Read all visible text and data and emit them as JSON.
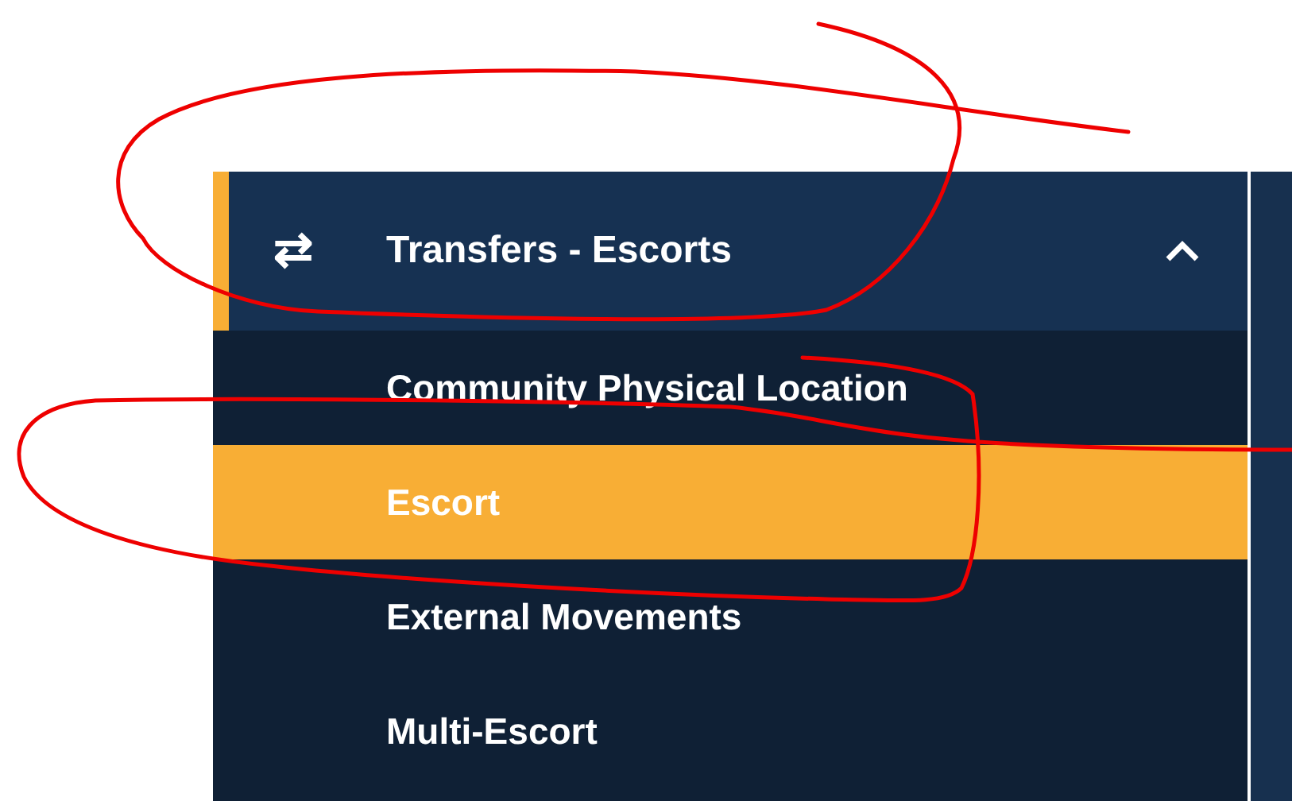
{
  "sidebar": {
    "section": {
      "icon": "⇄",
      "label": "Transfers - Escorts",
      "expanded": true
    },
    "items": [
      {
        "label": "Community Physical Location",
        "selected": false
      },
      {
        "label": "Escort",
        "selected": true
      },
      {
        "label": "External Movements",
        "selected": false
      },
      {
        "label": "Multi-Escort",
        "selected": false
      }
    ]
  },
  "annotations": [
    {
      "kind": "loop"
    },
    {
      "kind": "loop"
    }
  ]
}
